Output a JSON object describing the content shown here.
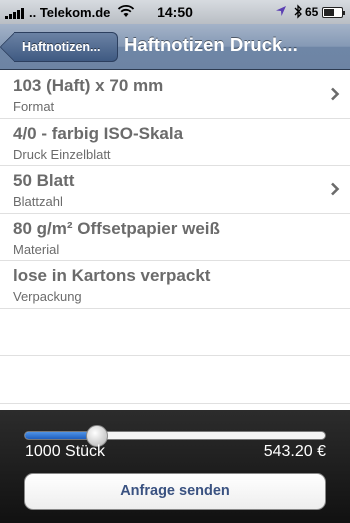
{
  "status_bar": {
    "carrier": ".. Telekom.de",
    "time": "14:50",
    "battery_percent": "65 %",
    "battery_level": 0.65,
    "icons": [
      "signal-icon",
      "wifi-icon",
      "location-icon",
      "bluetooth-icon",
      "battery-icon"
    ]
  },
  "nav_bar": {
    "back_label": "Haftnotizen...",
    "title": "Haftnotizen Druck..."
  },
  "list": {
    "items": [
      {
        "title": "103 (Haft) x 70 mm",
        "subtitle": "Format",
        "has_chevron": true
      },
      {
        "title": "4/0 - farbig ISO-Skala",
        "subtitle": "Druck Einzelblatt",
        "has_chevron": false
      },
      {
        "title": "50 Blatt",
        "subtitle": "Blattzahl",
        "has_chevron": true
      },
      {
        "title": "80 g/m² Offsetpapier weiß",
        "subtitle": "Material",
        "has_chevron": false
      },
      {
        "title": "lose in Kartons verpackt",
        "subtitle": "Verpackung",
        "has_chevron": false
      }
    ]
  },
  "order": {
    "quantity_label": "1000 Stück",
    "price_label": "543.20 €",
    "slider_level": 0.24,
    "send_label": "Anfrage senden"
  },
  "colors": {
    "nav_bar": "#7a8fae",
    "slider_fill": "#2f73d4",
    "button_text": "#3a5281",
    "row_text": "#6b6b6b"
  }
}
